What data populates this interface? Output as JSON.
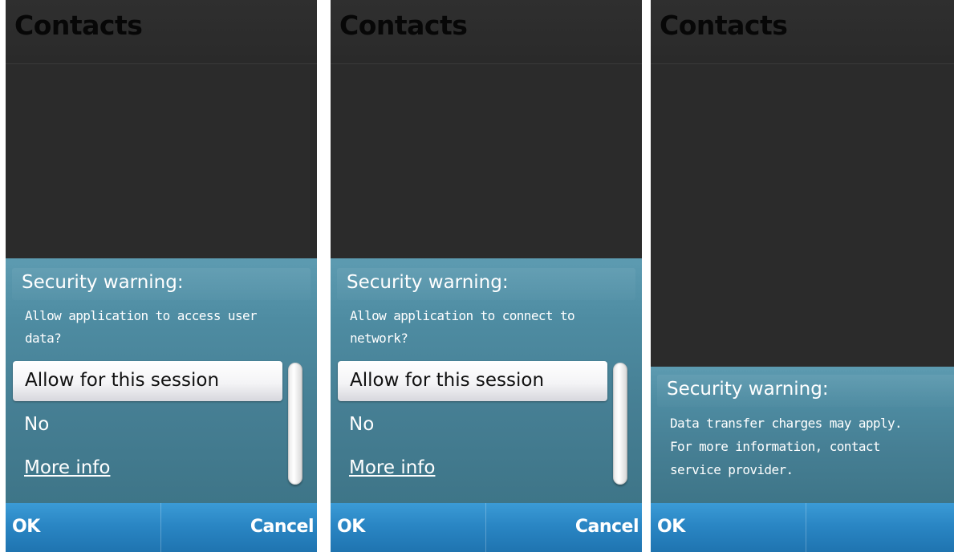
{
  "screens": [
    {
      "app_title": "Contacts",
      "dialog_title": "Security warning:",
      "message_lines": [
        "Allow application to access user",
        "data?"
      ],
      "options": {
        "selected": "Allow for this session",
        "no": "No",
        "more_info": "More info"
      },
      "softkeys": {
        "left": "OK",
        "right": "Cancel"
      }
    },
    {
      "app_title": "Contacts",
      "dialog_title": "Security warning:",
      "message_lines": [
        "Allow application to connect to",
        "network?"
      ],
      "options": {
        "selected": "Allow for this session",
        "no": "No",
        "more_info": "More info"
      },
      "softkeys": {
        "left": "OK",
        "right": "Cancel"
      }
    },
    {
      "app_title": "Contacts",
      "dialog_title": "Security warning:",
      "message_lines": [
        "Data transfer charges may apply.",
        "For more information, contact",
        "service provider."
      ],
      "softkeys": {
        "left": "OK"
      }
    }
  ],
  "colors": {
    "app_background": "#2b2b2b",
    "dialog_background": "#4e8ca2",
    "softkey_bar": "#2a86c4"
  }
}
